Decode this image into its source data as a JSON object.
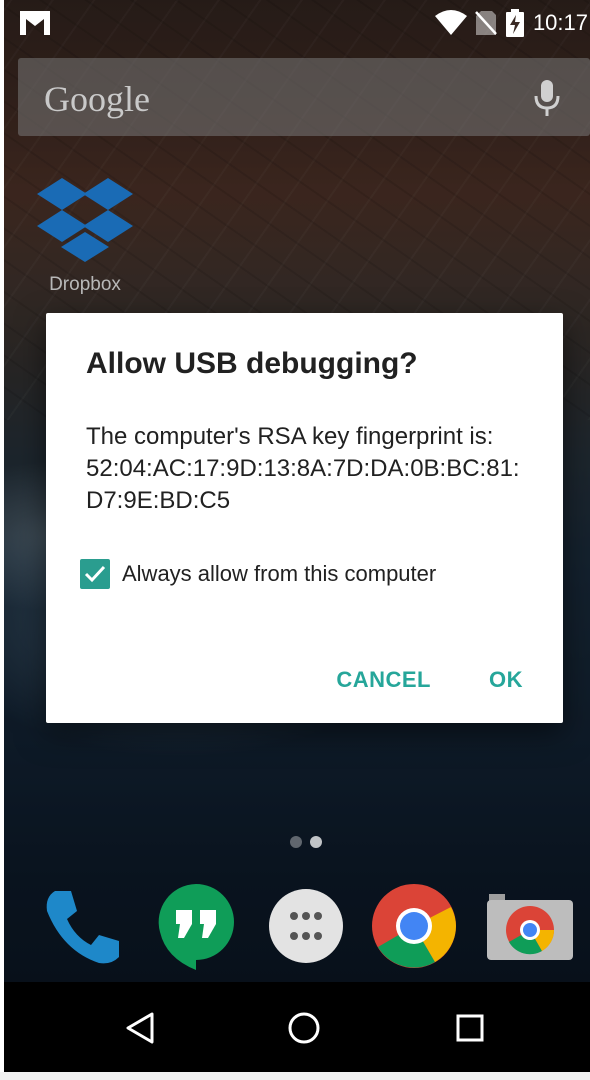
{
  "status_bar": {
    "time": "10:17",
    "icons": [
      "gmail-icon",
      "wifi-icon",
      "no-sim-icon",
      "battery-charging-icon"
    ]
  },
  "search_bar": {
    "logo_text": "Google",
    "icon": "mic-icon"
  },
  "home": {
    "shortcut": {
      "label": "Dropbox",
      "icon": "dropbox-icon"
    },
    "page_indicator": {
      "pages": 2,
      "active_page": 2
    }
  },
  "dialog": {
    "title": "Allow USB debugging?",
    "body_line1": "The computer's RSA key fingerprint is:",
    "fingerprint": "52:04:AC:17:9D:13:8A:7D:DA:0B:BC:81:D7:9E:BD:C5",
    "checkbox_label": "Always allow from this computer",
    "checkbox_checked": true,
    "cancel_label": "CANCEL",
    "ok_label": "OK",
    "accent_color": "#26a69a"
  },
  "dock": {
    "apps": [
      "phone-icon",
      "hangouts-icon",
      "app-drawer-icon",
      "chrome-icon",
      "camera-icon"
    ]
  },
  "nav_bar": {
    "buttons": [
      "back-icon",
      "home-icon",
      "recents-icon"
    ]
  }
}
